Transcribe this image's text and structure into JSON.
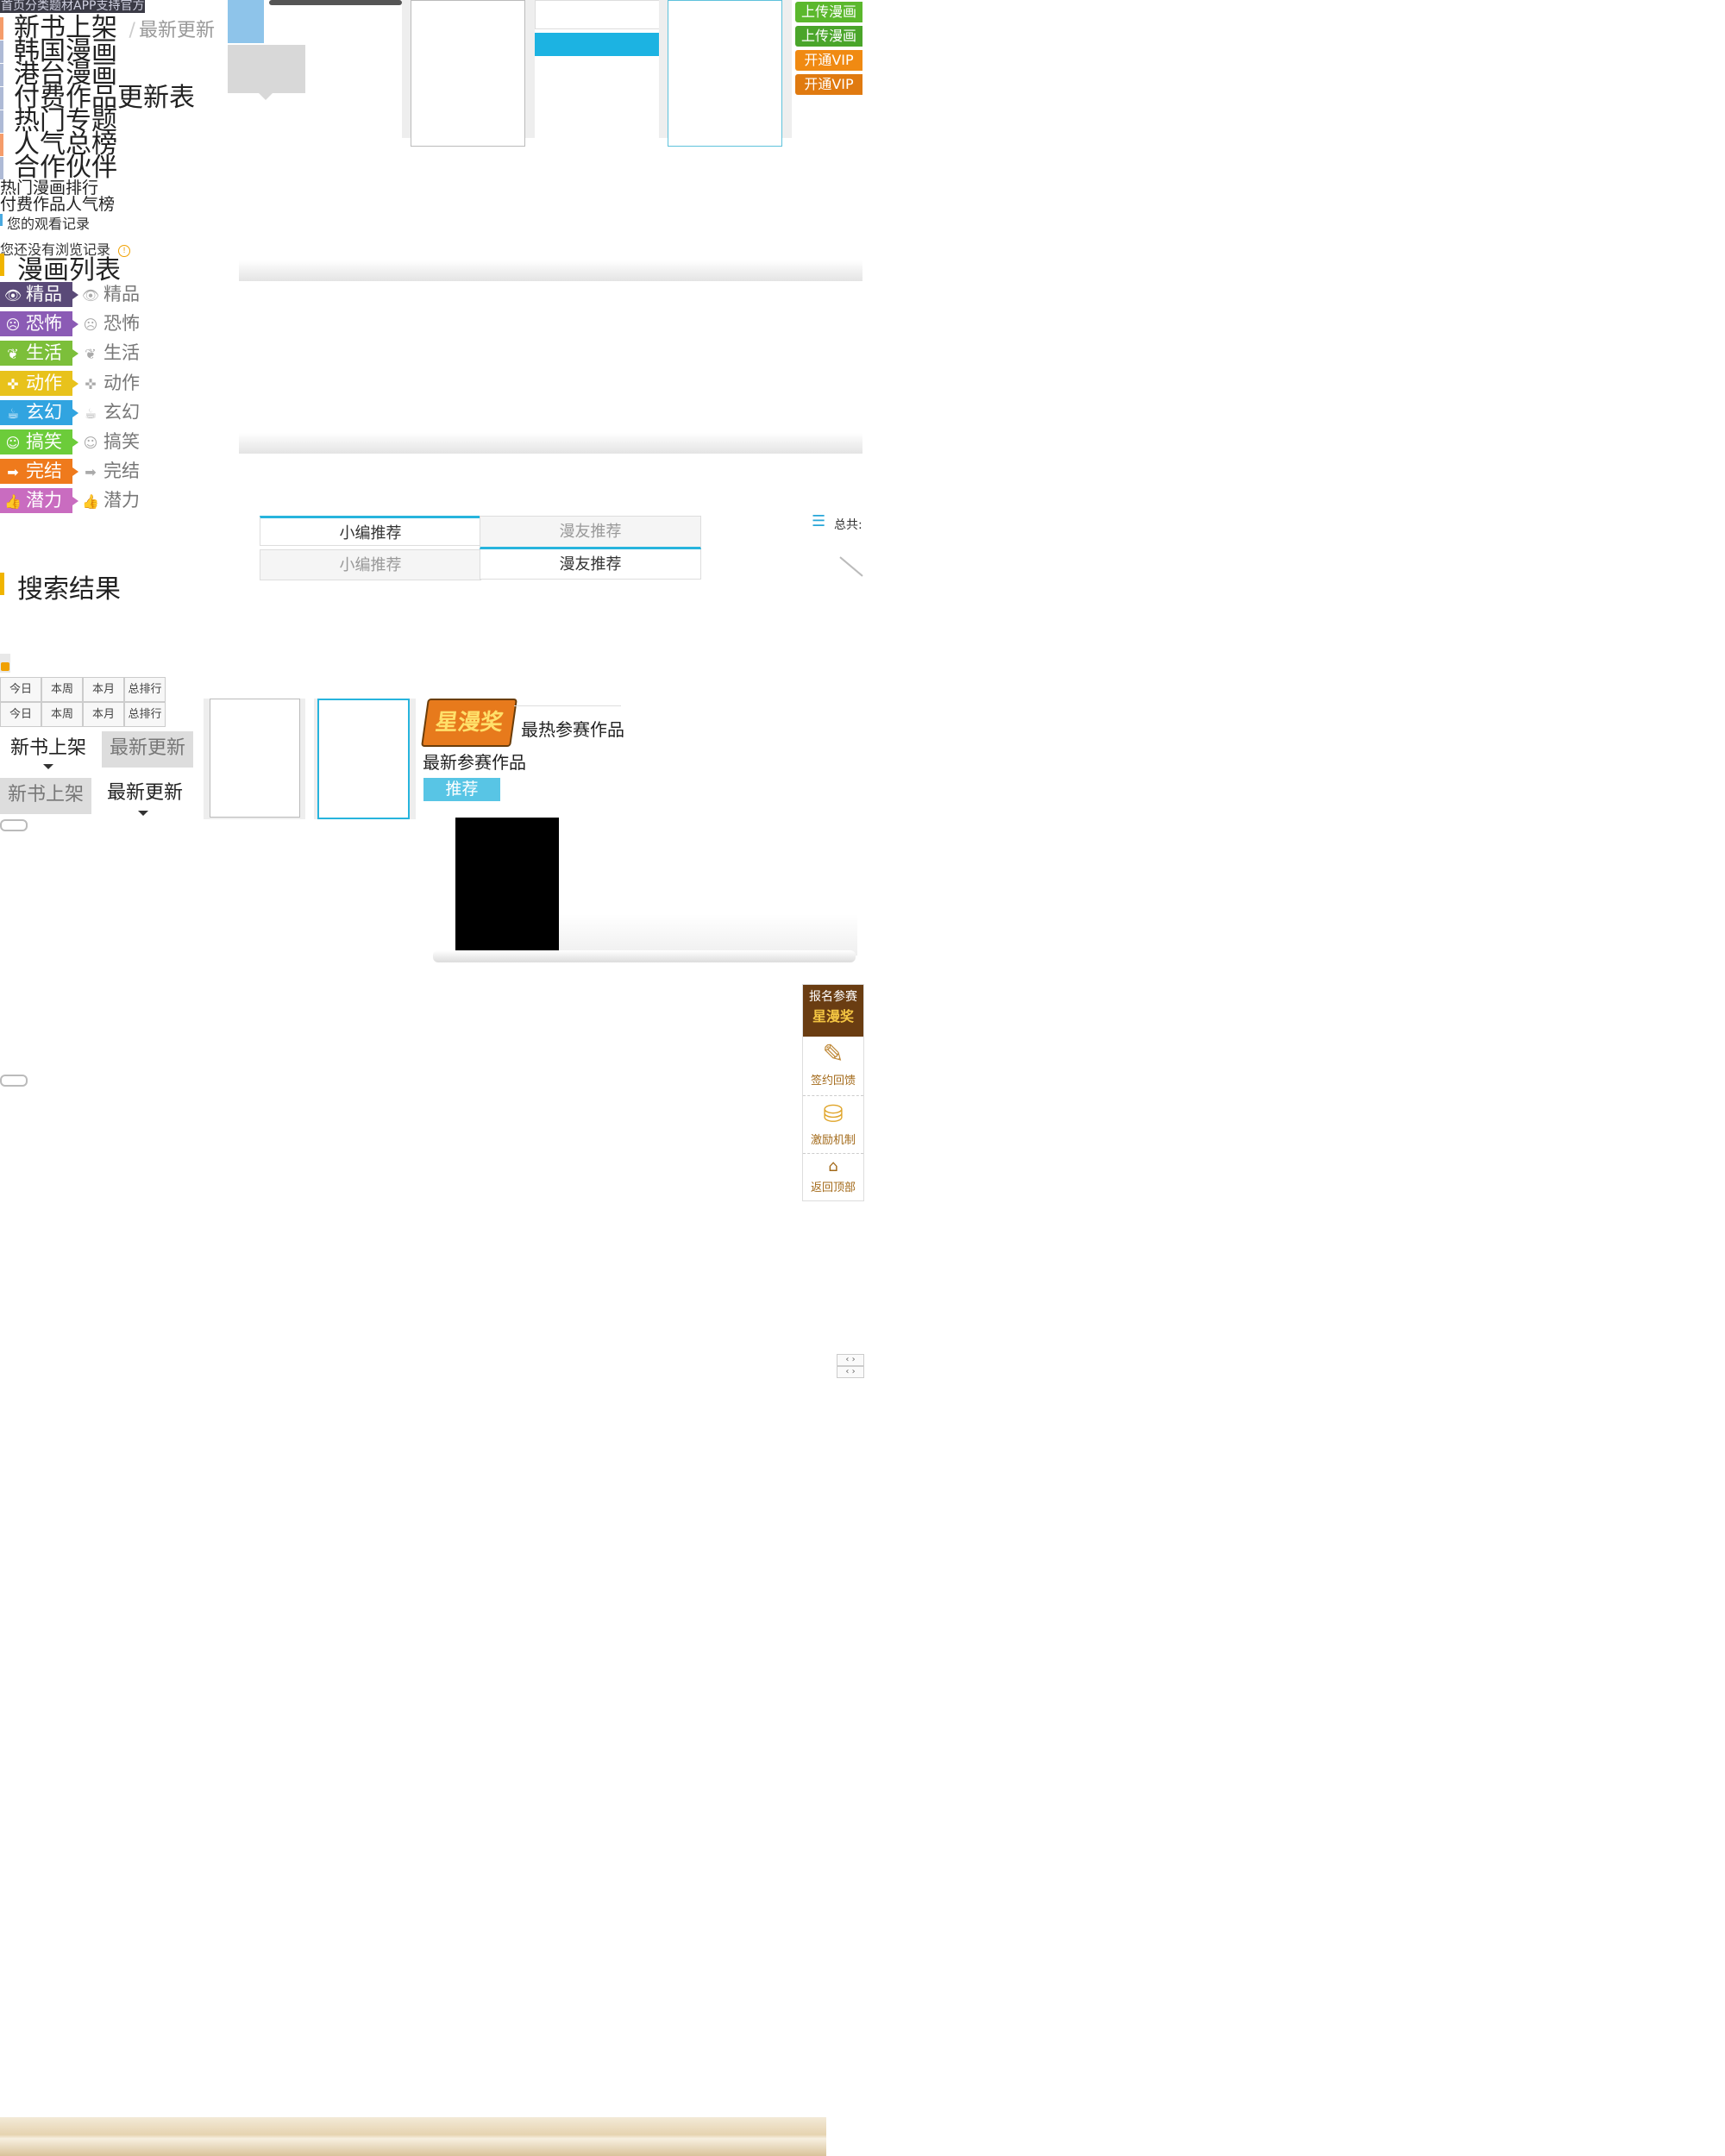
{
  "top_nav": {
    "items": [
      "首页",
      "分类",
      "题材",
      "APP",
      "支持",
      "官方"
    ]
  },
  "channels": [
    {
      "label": "新书上架",
      "bar": "#f59c6a"
    },
    {
      "label": "韩国漫画",
      "bar": "#aebad6"
    },
    {
      "label": "港台漫画",
      "bar": "#aebad6"
    },
    {
      "label": "付费作品更新表",
      "bar": "#aebad6"
    },
    {
      "label": "热门专题",
      "bar": "#aebad6"
    },
    {
      "label": "人气总榜",
      "bar": "#f59c6a"
    },
    {
      "label": "合作伙伴",
      "bar": "#aebad6"
    }
  ],
  "latest_update": {
    "slash": "/",
    "label": "最新更新"
  },
  "rankings": {
    "hot": "热门漫画排行",
    "paid": "付费作品人气榜"
  },
  "history": {
    "title": "您的观看记录",
    "empty": "您还没有浏览记录",
    "info_icon": "!"
  },
  "comic_list": {
    "title": "漫画列表"
  },
  "genres": [
    {
      "label": "精品",
      "icon": "eye-icon",
      "glyph": "👁",
      "color": "#5a4a78"
    },
    {
      "label": "恐怖",
      "icon": "skull-icon",
      "glyph": "☹",
      "color": "#8b5bb5"
    },
    {
      "label": "生活",
      "icon": "leaf-icon",
      "glyph": "❦",
      "color": "#7cbf3a"
    },
    {
      "label": "动作",
      "icon": "gamepad-icon",
      "glyph": "✜",
      "color": "#e8c21c"
    },
    {
      "label": "玄幻",
      "icon": "cauldron-icon",
      "glyph": "☕",
      "color": "#31a4e0"
    },
    {
      "label": "搞笑",
      "icon": "smile-icon",
      "glyph": "☺",
      "color": "#6ccc3a"
    },
    {
      "label": "完结",
      "icon": "arrow-icon",
      "glyph": "➡",
      "color": "#ef7a1c"
    },
    {
      "label": "潜力",
      "icon": "thumb-icon",
      "glyph": "👍",
      "color": "#c96cc0"
    }
  ],
  "search_results": {
    "title": "搜索结果"
  },
  "side_buttons": [
    {
      "label": "上传漫画",
      "color": "#5bb82d"
    },
    {
      "label": "上传漫画",
      "color": "#4aa52a"
    },
    {
      "label": "开通VIP",
      "color": "#f08a12"
    },
    {
      "label": "开通VIP",
      "color": "#e07a10"
    }
  ],
  "rec_tabs": {
    "editor": "小编推荐",
    "fans": "漫友推荐"
  },
  "total_label": "总共:",
  "rank_tabs": [
    "今日",
    "本周",
    "本月",
    "总排行"
  ],
  "shelf_tabs": {
    "new": "新书上架",
    "latest": "最新更新"
  },
  "contest": {
    "badge": "星漫奖",
    "hottest": "最热参赛作品",
    "newest": "最新参赛作品",
    "recommend": "推荐"
  },
  "side_panel": {
    "signup": "报名参赛",
    "badge": "星漫奖",
    "sign": "签约回馈",
    "reward": "激励机制",
    "top": "返回顶部"
  }
}
